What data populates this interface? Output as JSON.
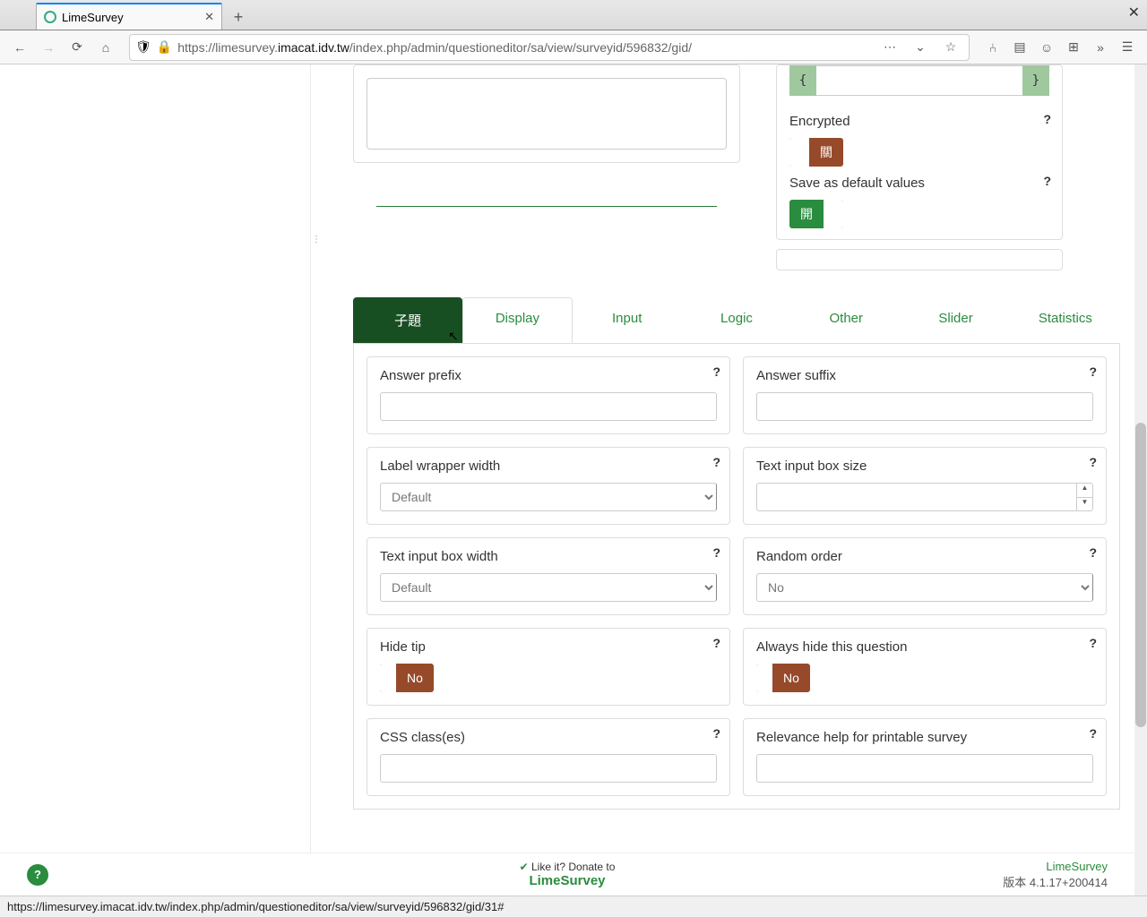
{
  "browser": {
    "tab_title": "LimeSurvey",
    "url_pre": "https://limesurvey.",
    "url_dom": "imacat.idv.tw",
    "url_post": "/index.php/admin/questioneditor/sa/view/surveyid/596832/gid/",
    "status_url": "https://limesurvey.imacat.idv.tw/index.php/admin/questioneditor/sa/view/surveyid/596832/gid/31#"
  },
  "side": {
    "encrypted": {
      "label": "Encrypted",
      "state": "關"
    },
    "save_default": {
      "label": "Save as default values",
      "state": "開"
    }
  },
  "tabs": [
    "子題",
    "Display",
    "Input",
    "Logic",
    "Other",
    "Slider",
    "Statistics"
  ],
  "options": {
    "answer_prefix": "Answer prefix",
    "answer_suffix": "Answer suffix",
    "label_wrapper": "Label wrapper width",
    "label_wrapper_val": "Default",
    "text_box_size": "Text input box size",
    "text_box_width": "Text input box width",
    "text_box_width_val": "Default",
    "random_order": "Random order",
    "random_order_val": "No",
    "hide_tip": "Hide tip",
    "hide_tip_val": "No",
    "always_hide": "Always hide this question",
    "always_hide_val": "No",
    "css_class": "CSS class(es)",
    "relevance_help": "Relevance help for printable survey"
  },
  "footer": {
    "donate1": "Like it? Donate to",
    "donate2": "LimeSurvey",
    "brand": "LimeSurvey",
    "version": "版本 4.1.17+200414"
  }
}
